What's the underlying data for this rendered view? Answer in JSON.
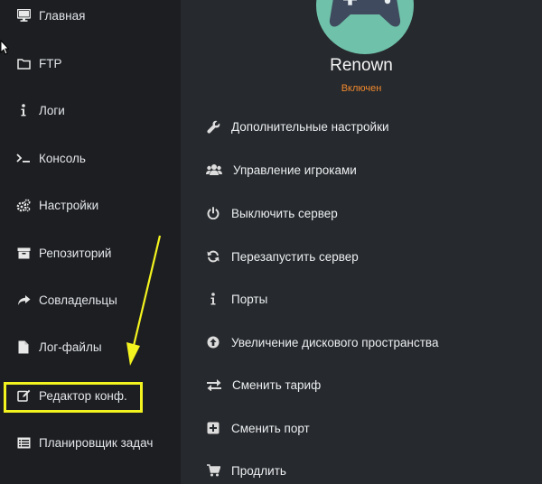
{
  "sidebar": {
    "items": [
      {
        "label": "Главная",
        "icon": "desktop-icon"
      },
      {
        "label": "FTP",
        "icon": "folder-icon"
      },
      {
        "label": "Логи",
        "icon": "info-icon"
      },
      {
        "label": "Консоль",
        "icon": "terminal-icon"
      },
      {
        "label": "Настройки",
        "icon": "cogs-icon"
      },
      {
        "label": "Репозиторий",
        "icon": "archive-icon"
      },
      {
        "label": "Совладельцы",
        "icon": "share-icon"
      },
      {
        "label": "Лог-файлы",
        "icon": "file-icon"
      },
      {
        "label": "Редактор конф.",
        "icon": "edit-icon"
      },
      {
        "label": "Планировщик задач",
        "icon": "list-icon"
      }
    ]
  },
  "server": {
    "name": "Renown",
    "status": "Включен",
    "avatar_icon": "gamepad-icon"
  },
  "menu": {
    "items": [
      {
        "label": "Дополнительные настройки",
        "icon": "wrench-icon"
      },
      {
        "label": "Управление игроками",
        "icon": "users-icon"
      },
      {
        "label": "Выключить сервер",
        "icon": "power-icon"
      },
      {
        "label": "Перезапустить сервер",
        "icon": "refresh-icon"
      },
      {
        "label": "Порты",
        "icon": "info-icon"
      },
      {
        "label": "Увеличение дискового пространства",
        "icon": "arrow-up-circle-icon"
      },
      {
        "label": "Сменить тариф",
        "icon": "exchange-icon"
      },
      {
        "label": "Сменить порт",
        "icon": "plus-square-icon"
      },
      {
        "label": "Продлить",
        "icon": "cart-icon"
      }
    ]
  },
  "colors": {
    "sidebar_bg": "#1c1e21",
    "main_bg": "#26292d",
    "status": "#f0892f",
    "avatar": "#6fc1a9",
    "highlight": "#f3f31f"
  }
}
